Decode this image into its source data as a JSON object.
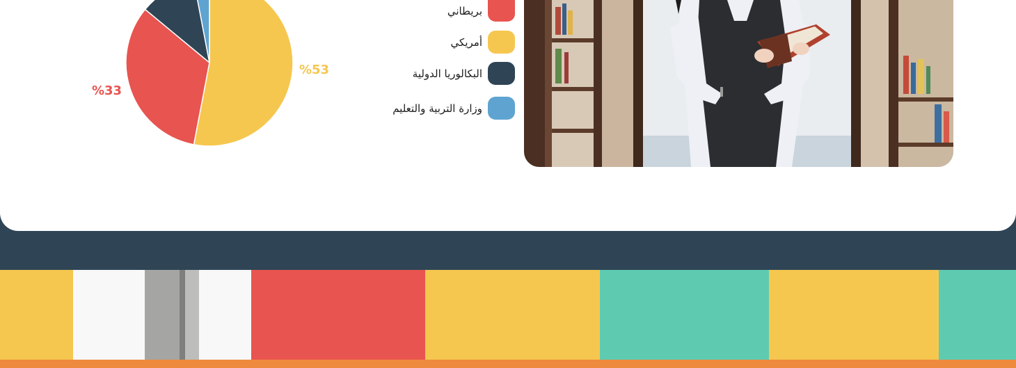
{
  "chart_data": {
    "type": "pie",
    "title": "",
    "slices": [
      {
        "label": "أمريكي",
        "value": 53,
        "color": "#f6c74f"
      },
      {
        "label": "بريطاني",
        "value": 33,
        "color": "#e85450"
      },
      {
        "label": "البكالوريا الدولية",
        "value": 11,
        "color": "#2f4556"
      },
      {
        "label": "وزارة التربية والتعليم",
        "value": 3,
        "color": "#5fa4d1"
      }
    ],
    "data_labels": [
      {
        "text": "%53",
        "color": "#f6c74f"
      },
      {
        "text": "%33",
        "color": "#e85450"
      }
    ],
    "legend_position": "right"
  },
  "legend": {
    "items": [
      {
        "label": "بريطاني",
        "color": "#e85450"
      },
      {
        "label": "أمريكي",
        "color": "#f6c74f"
      },
      {
        "label": "البكالوريا الدولية",
        "color": "#2f4556"
      },
      {
        "label": "وزارة التربية والتعليم",
        "color": "#5fa4d1"
      }
    ]
  },
  "colors": {
    "dark_band": "#2f4556",
    "orange_band": "#ee8a3d",
    "strip_yellow": "#f6c74f",
    "strip_red": "#e85450",
    "strip_teal": "#5ecbb1",
    "strip_white": "#f8f8f8"
  },
  "photo": {
    "alt": "student-reading-in-library"
  }
}
